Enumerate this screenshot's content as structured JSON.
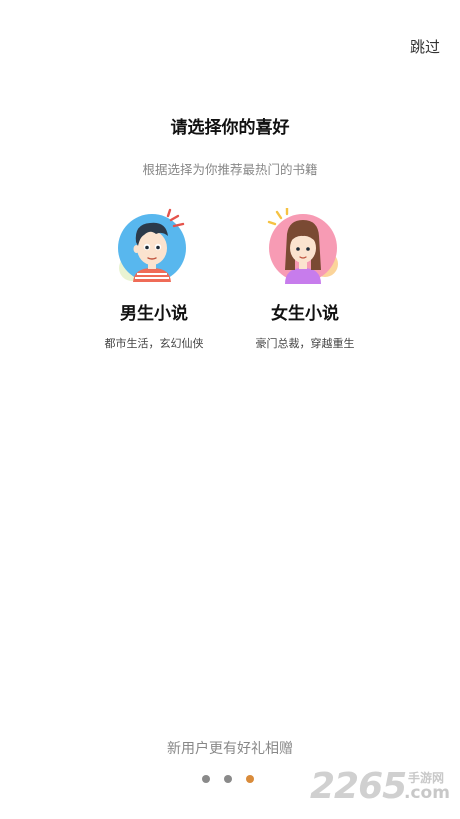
{
  "header": {
    "skip_label": "跳过"
  },
  "main": {
    "title": "请选择你的喜好",
    "subtitle": "根据选择为你推荐最热门的书籍",
    "options": [
      {
        "title": "男生小说",
        "desc": "都市生活，玄幻仙侠",
        "icon": "boy-avatar-icon"
      },
      {
        "title": "女生小说",
        "desc": "豪门总裁，穿越重生",
        "icon": "girl-avatar-icon"
      }
    ]
  },
  "footer": {
    "promo": "新用户更有好礼相赠",
    "pager": {
      "count": 3,
      "active_index": 2
    }
  },
  "watermark": {
    "number": "2265",
    "site": "手游网",
    "domain": ".com"
  },
  "colors": {
    "accent": "#d98b3a",
    "dot": "#8a8a8a",
    "male_bg": "#58b7ee",
    "female_bg": "#f79bb4"
  }
}
